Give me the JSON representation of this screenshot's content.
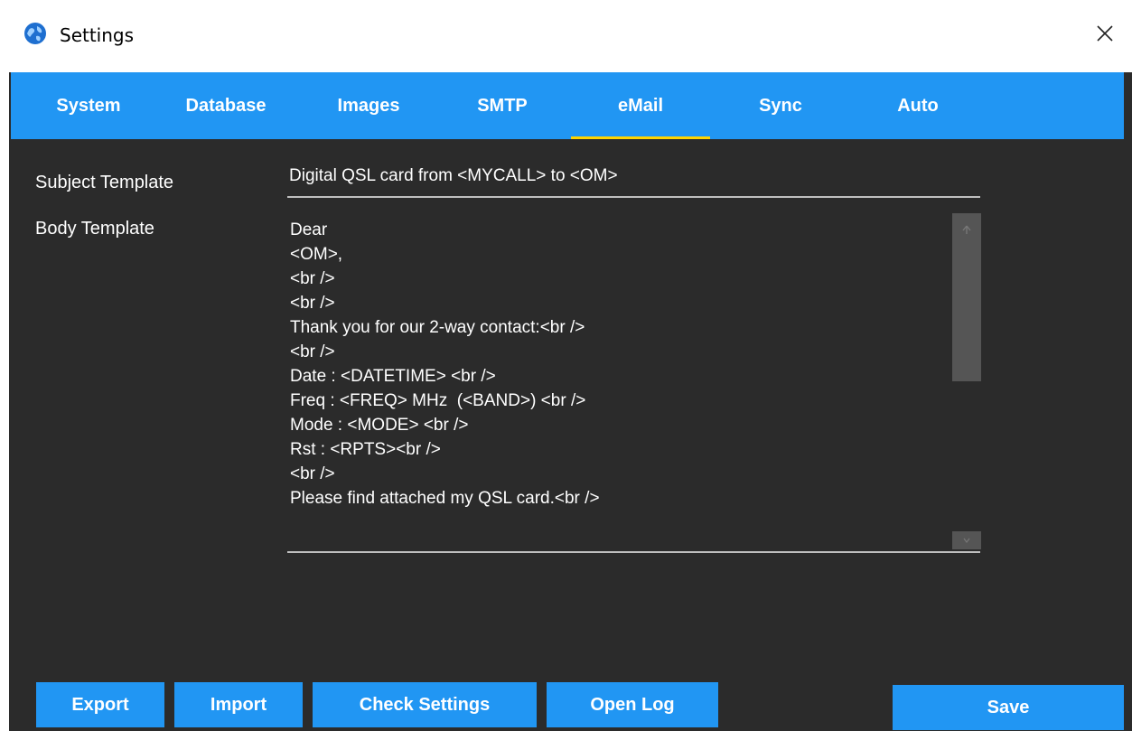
{
  "window": {
    "title": "Settings"
  },
  "tabs": [
    {
      "label": "System"
    },
    {
      "label": "Database"
    },
    {
      "label": "Images"
    },
    {
      "label": "SMTP"
    },
    {
      "label": "eMail",
      "active": true
    },
    {
      "label": "Sync"
    },
    {
      "label": "Auto"
    }
  ],
  "email": {
    "subject_label": "Subject Template",
    "subject_value": "Digital QSL card from <MYCALL> to <OM>",
    "body_label": "Body Template",
    "body_lines": [
      "Dear",
      "<OM>,",
      "<br />",
      "<br />",
      "Thank you for our 2-way contact:<br />",
      "<br />",
      "Date : <DATETIME> <br />",
      "Freq : <FREQ> MHz  (<BAND>) <br />",
      "Mode : <MODE> <br />",
      "Rst : <RPTS><br />",
      "<br />",
      "Please find attached my QSL card.<br />"
    ]
  },
  "buttons": {
    "export": "Export",
    "import": "Import",
    "check_settings": "Check Settings",
    "open_log": "Open Log",
    "save": "Save"
  },
  "colors": {
    "accent": "#2196f3",
    "active_tab_indicator": "#ffd400",
    "panel_background": "#2b2b2b"
  }
}
